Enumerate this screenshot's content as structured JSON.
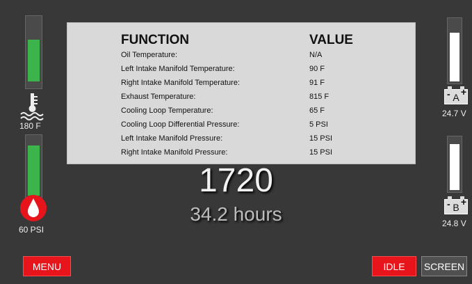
{
  "panel": {
    "header_function": "FUNCTION",
    "header_value": "VALUE",
    "rows": [
      {
        "function": "Oil Temperature:",
        "value": "N/A"
      },
      {
        "function": "Left Intake Manifold Temperature:",
        "value": "90 F"
      },
      {
        "function": "Right Intake Manifold Temperature:",
        "value": "91 F"
      },
      {
        "function": "Exhaust Temperature:",
        "value": "815 F"
      },
      {
        "function": "Cooling Loop Temperature:",
        "value": "65 F"
      },
      {
        "function": "Cooling Loop Differential Pressure:",
        "value": "5 PSI"
      },
      {
        "function": "Left Intake Manifold Pressure:",
        "value": "15 PSI"
      },
      {
        "function": "Right Intake Manifold Pressure:",
        "value": "15 PSI"
      }
    ]
  },
  "readout": {
    "rpm": "1720",
    "hours": "34.2 hours"
  },
  "left_gauges": {
    "temperature_label": "180 F",
    "pressure_label": "60 PSI",
    "temperature_icon": "coolant-temperature-icon",
    "pressure_icon": "oil-pressure-drop-icon"
  },
  "right_gauges": {
    "battery_a": {
      "letter": "A",
      "minus": "-",
      "plus": "+",
      "voltage": "24.7 V"
    },
    "battery_b": {
      "letter": "B",
      "minus": "-",
      "plus": "+",
      "voltage": "24.8 V"
    }
  },
  "buttons": {
    "menu": "MENU",
    "idle": "IDLE",
    "screen": "SCREEN"
  },
  "colors": {
    "background": "#383838",
    "gauge_green": "#3cb44b",
    "alert_red": "#e8141c",
    "panel_gray": "#d9d9d9"
  }
}
